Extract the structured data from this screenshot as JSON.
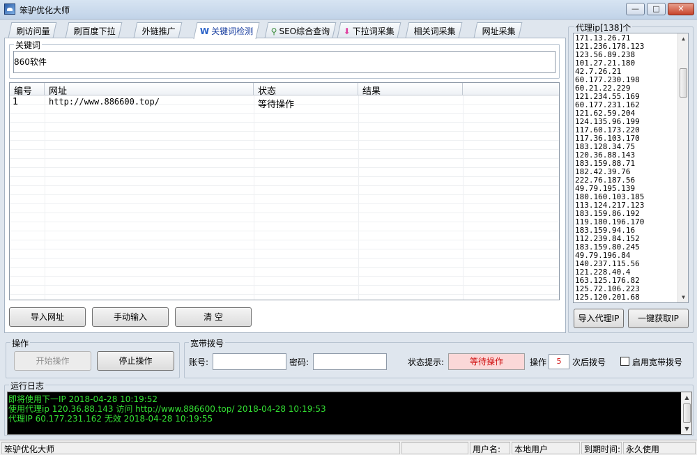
{
  "window": {
    "title": "笨驴优化大师",
    "minimize_icon": "minimize-icon",
    "maximize_icon": "maximize-icon",
    "close_icon": "close-icon"
  },
  "tabs": [
    {
      "label": "刷访问量",
      "icon": "exclamation-icon",
      "color": "#f0a000"
    },
    {
      "label": "刷百度下拉",
      "icon": "download-icon",
      "color": "#4a7fd0"
    },
    {
      "label": "外链推广",
      "icon": "link-icon",
      "color": "#5a8a3a"
    },
    {
      "label": "关键词检测",
      "icon": "word-w-icon",
      "color": "#2a62c8"
    },
    {
      "label": "SEO综合查询",
      "icon": "magnifier-icon",
      "color": "#3c8c3c"
    },
    {
      "label": "下拉词采集",
      "icon": "pink-arrow-icon",
      "color": "#e040a0"
    },
    {
      "label": "相关词采集",
      "icon": "globe-icon",
      "color": "#3a8ad8"
    },
    {
      "label": "网址采集",
      "icon": "ie-icon",
      "color": "#2858b0"
    }
  ],
  "keyword": {
    "group_title": "关键词",
    "value": "860软件"
  },
  "table": {
    "columns": [
      "编号",
      "网址",
      "状态",
      "结果"
    ],
    "rows": [
      {
        "id": "1",
        "url": "http://www.886600.top/",
        "status": "等待操作",
        "result": ""
      }
    ]
  },
  "buttons": {
    "import_url": "导入网址",
    "manual_input": "手动输入",
    "clear": "清 空",
    "import_proxy": "导入代理IP",
    "get_ip": "一键获取IP",
    "start": "开始操作",
    "stop": "停止操作"
  },
  "proxy": {
    "title": "代理ip[138]个",
    "items": [
      "171.13.26.71",
      "121.236.178.123",
      "123.56.89.238",
      "101.27.21.180",
      "42.7.26.21",
      "60.177.230.198",
      "60.21.22.229",
      "121.234.55.169",
      "60.177.231.162",
      "121.62.59.204",
      "124.135.96.199",
      "117.60.173.220",
      "117.36.103.170",
      "183.128.34.75",
      "120.36.88.143",
      "183.159.88.71",
      "182.42.39.76",
      "222.76.187.56",
      "49.79.195.139",
      "180.160.103.185",
      "113.124.217.123",
      "183.159.86.192",
      "119.180.196.170",
      "183.159.94.16",
      "112.239.84.152",
      "183.159.80.245",
      "49.79.196.84",
      "140.237.115.56",
      "121.228.40.4",
      "163.125.176.82",
      "125.72.106.223",
      "125.120.201.68"
    ]
  },
  "operation": {
    "group_title": "操作"
  },
  "broadband": {
    "group_title": "宽带拨号",
    "account_label": "账号:",
    "password_label": "密码:",
    "status_label": "状态提示:",
    "status_value": "等待操作",
    "op_label": "操作",
    "op_count": "5",
    "after_label": "次后拨号",
    "enable_label": "启用宽带拨号",
    "enabled": false
  },
  "log": {
    "group_title": "运行日志",
    "lines": [
      "即将使用下一IP 2018-04-28 10:19:52",
      "使用代理ip 120.36.88.143 访问 http://www.886600.top/ 2018-04-28 10:19:53",
      "代理IP 60.177.231.162 无效 2018-04-28 10:19:55"
    ]
  },
  "statusbar": {
    "app_name": "笨驴优化大师",
    "user_label": "用户名:",
    "user_value": "本地用户",
    "expire_label": "到期时间:",
    "expire_value": "永久使用"
  }
}
